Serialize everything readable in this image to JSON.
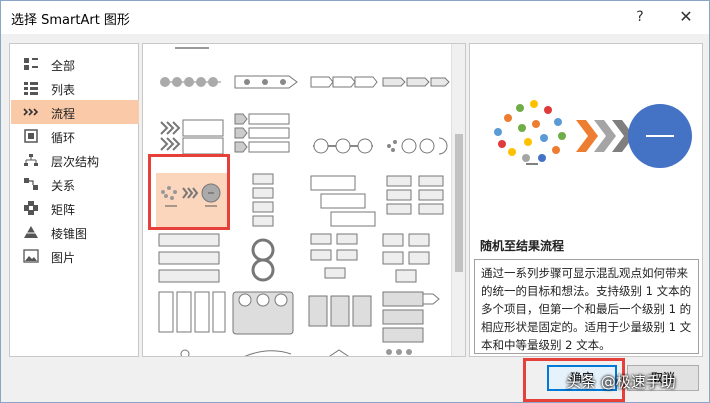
{
  "dialog": {
    "title": "选择 SmartArt 图形",
    "help_label": "?",
    "close_label": "✕"
  },
  "categories": [
    {
      "label": "全部",
      "icon": "all-icon"
    },
    {
      "label": "列表",
      "icon": "list-icon"
    },
    {
      "label": "流程",
      "icon": "process-icon",
      "selected": true
    },
    {
      "label": "循环",
      "icon": "cycle-icon"
    },
    {
      "label": "层次结构",
      "icon": "hierarchy-icon"
    },
    {
      "label": "关系",
      "icon": "relationship-icon"
    },
    {
      "label": "矩阵",
      "icon": "matrix-icon"
    },
    {
      "label": "棱锥图",
      "icon": "pyramid-icon"
    },
    {
      "label": "图片",
      "icon": "picture-icon"
    }
  ],
  "preview": {
    "layout_name": "随机至结果流程",
    "description": "通过一系列步骤可显示混乱观点如何带来的统一的目标和想法。支持级别 1 文本的多个项目，但第一个和最后一个级别 1 的相应形状是固定的。适用于少量级别 1 文本和中等量级别 2 文本。",
    "circle_label": "—",
    "accent": "#4472c4",
    "arrow_color": "#ed7d31"
  },
  "buttons": {
    "ok": "确定",
    "cancel": "取消"
  },
  "watermark": "头条 @极速手助"
}
